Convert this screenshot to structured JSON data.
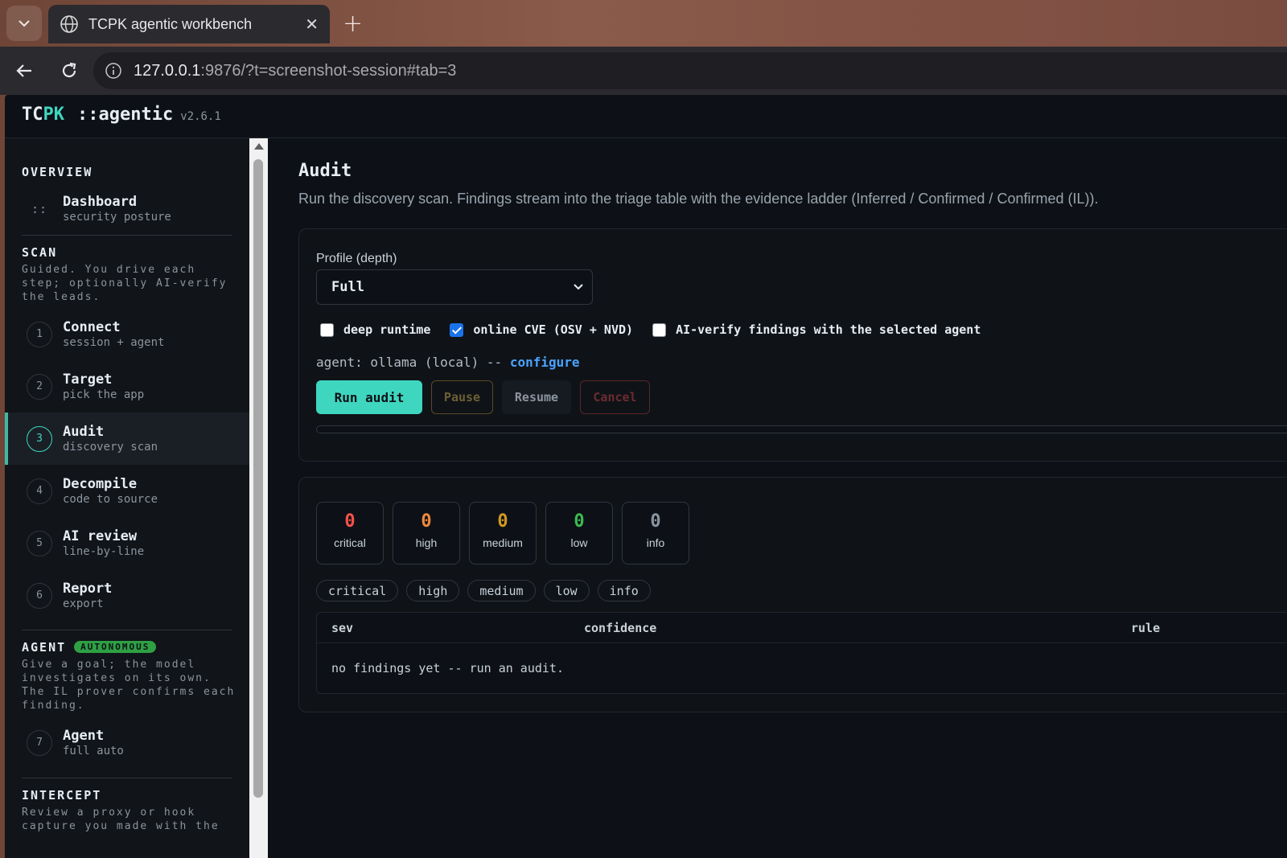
{
  "browser": {
    "tab_title": "TCPK agentic workbench",
    "url_host": "127.0.0.1",
    "url_rest": ":9876/?t=screenshot-session#tab=3"
  },
  "app": {
    "brand_tc": "TC",
    "brand_pk": "PK",
    "brand_sub": "::agentic",
    "version": "v2.6.1"
  },
  "sidebar": {
    "overview": {
      "title": "OVERVIEW",
      "items": [
        {
          "label": "Dashboard",
          "sub": "security posture",
          "marker": "::"
        }
      ]
    },
    "scan": {
      "title": "SCAN",
      "desc": "Guided. You drive each step; optionally AI-verify the leads.",
      "items": [
        {
          "num": "1",
          "label": "Connect",
          "sub": "session + agent"
        },
        {
          "num": "2",
          "label": "Target",
          "sub": "pick the app"
        },
        {
          "num": "3",
          "label": "Audit",
          "sub": "discovery scan"
        },
        {
          "num": "4",
          "label": "Decompile",
          "sub": "code to source"
        },
        {
          "num": "5",
          "label": "AI review",
          "sub": "line-by-line"
        },
        {
          "num": "6",
          "label": "Report",
          "sub": "export"
        }
      ]
    },
    "agent": {
      "title": "AGENT",
      "badge": "AUTONOMOUS",
      "desc": "Give a goal; the model investigates on its own. The IL prover confirms each finding.",
      "items": [
        {
          "num": "7",
          "label": "Agent",
          "sub": "full auto"
        }
      ]
    },
    "intercept": {
      "title": "INTERCEPT",
      "desc": "Review a proxy or hook capture you made with the"
    }
  },
  "main": {
    "title": "Audit",
    "desc": "Run the discovery scan. Findings stream into the triage table with the evidence ladder (Inferred / Confirmed / Confirmed (IL)).",
    "profile_label": "Profile (depth)",
    "profile_value": "Full",
    "checks": [
      {
        "label": "deep runtime",
        "checked": false
      },
      {
        "label": "online CVE (OSV + NVD)",
        "checked": true
      },
      {
        "label": "AI-verify findings with the selected agent",
        "checked": false
      }
    ],
    "agent_prefix": "agent: ollama (local) --",
    "agent_link": "configure",
    "buttons": {
      "run": "Run audit",
      "pause": "Pause",
      "resume": "Resume",
      "cancel": "Cancel"
    },
    "progress": 0
  },
  "results": {
    "counters": [
      {
        "num": "0",
        "cap": "critical",
        "color": "#f85149"
      },
      {
        "num": "0",
        "cap": "high",
        "color": "#f0883e"
      },
      {
        "num": "0",
        "cap": "medium",
        "color": "#d29922"
      },
      {
        "num": "0",
        "cap": "low",
        "color": "#3fb950"
      },
      {
        "num": "0",
        "cap": "info",
        "color": "#8b949e"
      }
    ],
    "filters": [
      "critical",
      "high",
      "medium",
      "low",
      "info"
    ],
    "columns": {
      "sev": "sev",
      "confidence": "confidence",
      "rule": "rule"
    },
    "empty": "no findings yet -- run an audit."
  }
}
